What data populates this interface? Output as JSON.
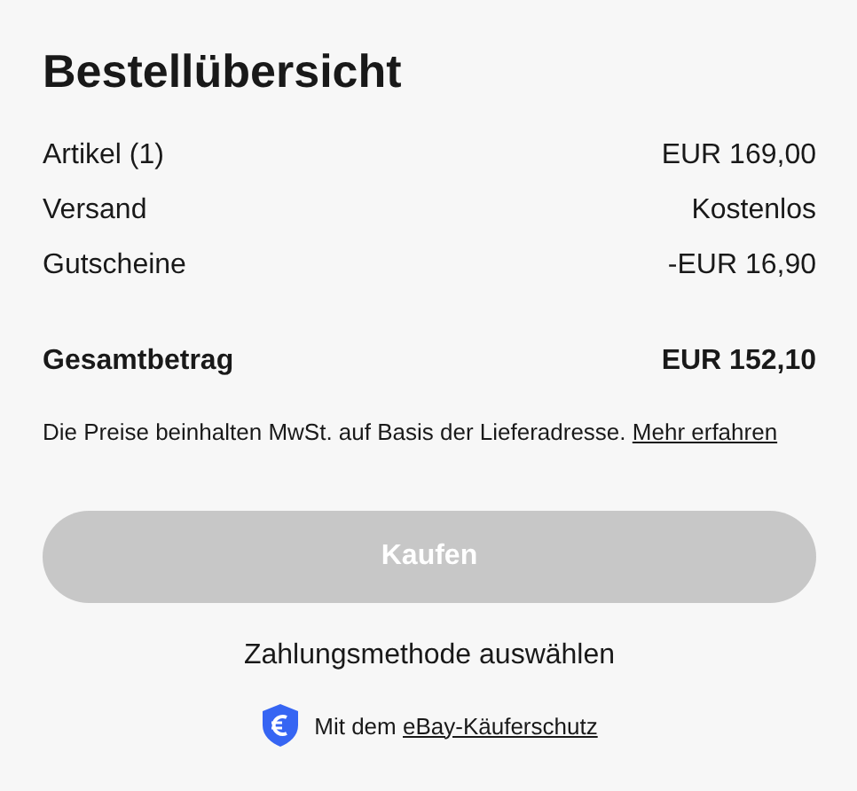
{
  "title": "Bestellübersicht",
  "rows": [
    {
      "label": "Artikel (1)",
      "value": "EUR 169,00"
    },
    {
      "label": "Versand",
      "value": "Kostenlos"
    },
    {
      "label": "Gutscheine",
      "value": "-EUR 16,90"
    }
  ],
  "total": {
    "label": "Gesamtbetrag",
    "value": "EUR 152,10"
  },
  "note": {
    "text": "Die Preise beinhalten MwSt. auf Basis der Lieferadresse.",
    "link": "Mehr erfahren"
  },
  "buy_button": {
    "label": "Kaufen",
    "disabled": true
  },
  "payment_link": "Zahlungsmethode auswählen",
  "protection": {
    "text": "Mit dem",
    "link": "eBay-Käuferschutz"
  }
}
